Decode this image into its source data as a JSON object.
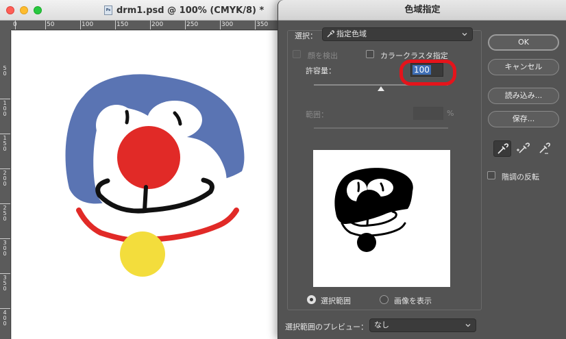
{
  "document": {
    "title": "drm1.psd @ 100% (CMYK/8) *",
    "file_icon": "Ps",
    "ruler_top_labels": [
      "0",
      "50",
      "100",
      "150",
      "200",
      "250",
      "300",
      "350"
    ],
    "ruler_left_labels": [
      "5\n0",
      "1\n0\n0",
      "1\n5\n0",
      "2\n0\n0",
      "2\n5\n0",
      "3\n0\n0",
      "3\n5\n0",
      "4\n0\n0"
    ]
  },
  "dialog": {
    "title": "色域指定",
    "select_label": "選択：",
    "select_value": "指定色域",
    "detect_faces_label": "顔を検出",
    "color_cluster_label": "カラークラスタ指定",
    "fuzziness_label": "許容量：",
    "fuzziness_value": "100",
    "range_label": "範囲：",
    "range_unit": "%",
    "buttons": {
      "ok": "OK",
      "cancel": "キャンセル",
      "load": "読み込み...",
      "save": "保存..."
    },
    "invert_label": "階調の反転",
    "radio_selection": "選択範囲",
    "radio_image": "画像を表示",
    "preview_label": "選択範囲のプレビュー：",
    "preview_value": "なし"
  },
  "colors": {
    "dialog_bg": "#535353",
    "annotation_ring": "#e4141b",
    "selection_highlight": "#3f6fb6"
  }
}
